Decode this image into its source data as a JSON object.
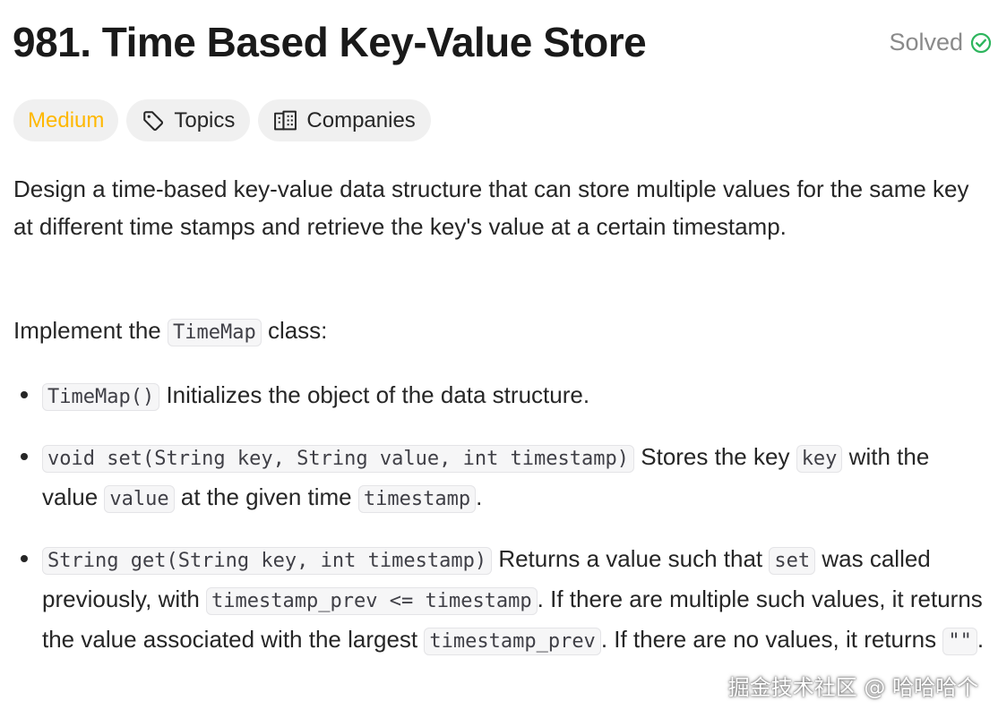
{
  "problem": {
    "title": "981. Time Based Key-Value Store",
    "status_label": "Solved",
    "difficulty": "Medium",
    "topics_label": "Topics",
    "companies_label": "Companies"
  },
  "description": {
    "intro": "Design a time-based key-value data structure that can store multiple values for the same key at different time stamps and retrieve the key's value at a certain timestamp.",
    "implement_prefix": "Implement the",
    "implement_code": "TimeMap",
    "implement_suffix": "class:",
    "methods": [
      {
        "code": "TimeMap()",
        "text": "Initializes the object of the data structure."
      },
      {
        "code": "void set(String key, String value, int timestamp)",
        "t1": "Stores the key",
        "c1": "key",
        "t2": "with the value",
        "c2": "value",
        "t3": "at the given time",
        "c3": "timestamp",
        "t4": "."
      },
      {
        "code": "String get(String key, int timestamp)",
        "t1": "Returns a value such that",
        "c1": "set",
        "t2": "was called previously, with",
        "c2": "timestamp_prev <= timestamp",
        "t3": ". If there are multiple such values, it returns the value associated with the largest",
        "c3": "timestamp_prev",
        "t4": ". If there are no values, it returns",
        "c4": "\"\"",
        "t5": "."
      }
    ]
  },
  "watermark": "掘金技术社区 @ 哈哈哈个",
  "colors": {
    "difficulty_medium": "#ffb800",
    "solved_check": "#2db55d",
    "chip_bg": "#f0f0f0"
  },
  "icons": {
    "solved": "check-circle-icon",
    "topics": "tag-icon",
    "companies": "building-icon"
  }
}
